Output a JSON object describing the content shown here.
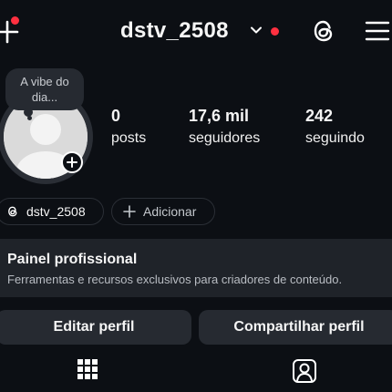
{
  "header": {
    "username": "dstv_2508",
    "icons": [
      "plus-icon",
      "chevron-down-icon",
      "threads-icon",
      "menu-icon"
    ],
    "notification_color": "#ff3040"
  },
  "note": {
    "text": "A vibe do dia..."
  },
  "stats": [
    {
      "value": "0",
      "label": "posts"
    },
    {
      "value": "17,6 mil",
      "label": "seguidores"
    },
    {
      "value": "242",
      "label": "seguindo"
    }
  ],
  "chips": {
    "threads_username": "dstv_2508",
    "add_label": "Adicionar"
  },
  "professional_panel": {
    "title": "Painel profissional",
    "subtitle": "Ferramentas e recursos exclusivos para criadores de conteúdo."
  },
  "buttons": {
    "edit": "Editar perfil",
    "share": "Compartilhar perfil"
  },
  "tabs": [
    "grid-icon",
    "tagged-icon"
  ],
  "colors": {
    "background": "#0c0f14",
    "panel": "#1f2329",
    "button": "#262a31"
  }
}
